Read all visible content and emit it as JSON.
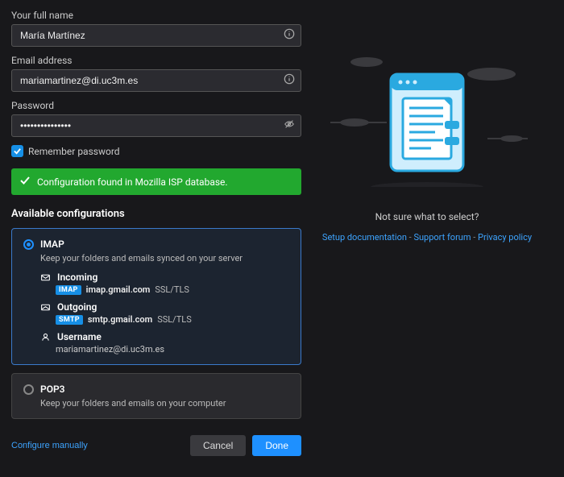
{
  "fullName": {
    "label": "Your full name",
    "value": "María Martínez"
  },
  "email": {
    "label": "Email address",
    "value": "mariamartinez@di.uc3m.es"
  },
  "password": {
    "label": "Password",
    "value": "•••••••••••••••"
  },
  "rememberPassword": "Remember password",
  "status": "Configuration found in Mozilla ISP database.",
  "availableTitle": "Available configurations",
  "configs": {
    "imap": {
      "title": "IMAP",
      "desc": "Keep your folders and emails synced on your server",
      "incomingLabel": "Incoming",
      "incomingBadge": "IMAP",
      "incomingHost": "imap.gmail.com",
      "incomingSec": "SSL/TLS",
      "outgoingLabel": "Outgoing",
      "outgoingBadge": "SMTP",
      "outgoingHost": "smtp.gmail.com",
      "outgoingSec": "SSL/TLS",
      "usernameLabel": "Username",
      "usernameValue": "mariamartinez@di.uc3m.es"
    },
    "pop3": {
      "title": "POP3",
      "desc": "Keep your folders and emails on your computer"
    }
  },
  "configureManually": "Configure manually",
  "cancel": "Cancel",
  "done": "Done",
  "rightPrompt": "Not sure what to select?",
  "links": {
    "setup": "Setup documentation",
    "support": "Support forum",
    "privacy": "Privacy policy"
  },
  "sep": " - "
}
